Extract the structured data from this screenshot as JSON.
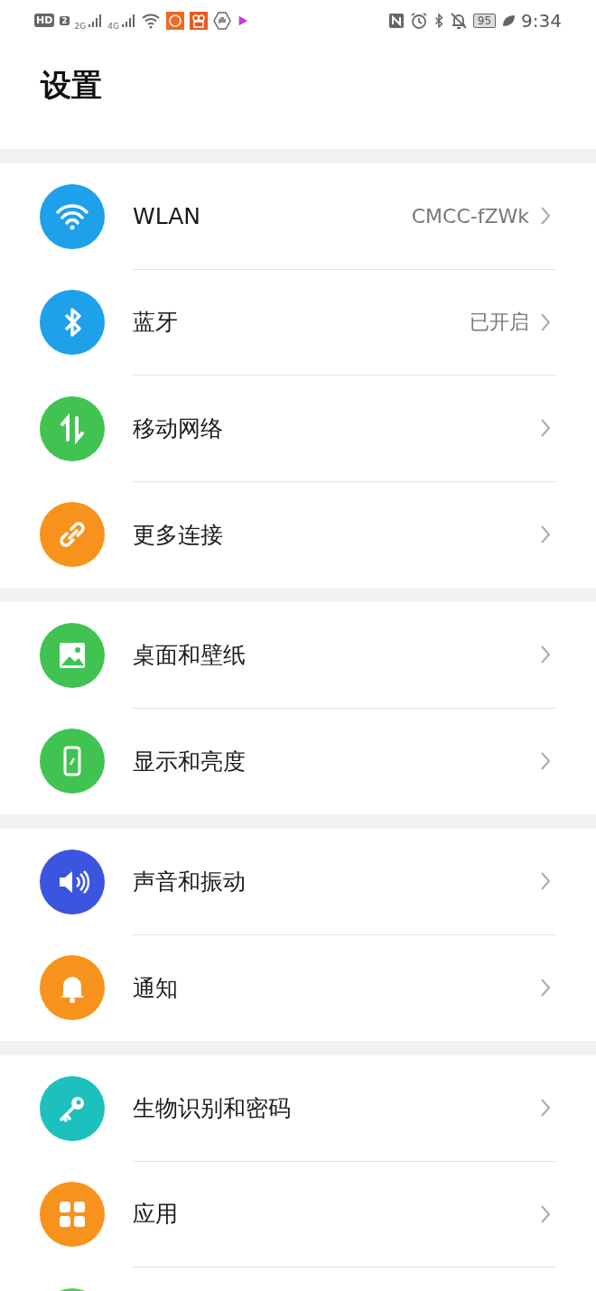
{
  "status_bar": {
    "hd": "HD",
    "sim": "2",
    "net1": "2G",
    "net2": "4G",
    "battery": "95",
    "time": "9:34"
  },
  "title": "设置",
  "groups": [
    {
      "items": [
        {
          "label": "WLAN",
          "value": "CMCC-fZWk",
          "color": "#1ea0ea"
        },
        {
          "label": "蓝牙",
          "value": "已开启",
          "color": "#1ea0ea"
        },
        {
          "label": "移动网络",
          "color": "#40c351"
        },
        {
          "label": "更多连接",
          "color": "#f7931c"
        }
      ]
    },
    {
      "items": [
        {
          "label": "桌面和壁纸",
          "color": "#40c351"
        },
        {
          "label": "显示和亮度",
          "color": "#40c351"
        }
      ]
    },
    {
      "items": [
        {
          "label": "声音和振动",
          "color": "#3b55df"
        },
        {
          "label": "通知",
          "color": "#f7931c"
        }
      ]
    },
    {
      "items": [
        {
          "label": "生物识别和密码",
          "color": "#1cc0bd"
        },
        {
          "label": "应用",
          "color": "#f7931c"
        },
        {
          "color": "#5cc45a"
        }
      ]
    }
  ]
}
